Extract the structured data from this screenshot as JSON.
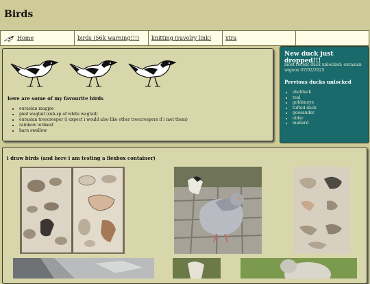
{
  "site": {
    "title": "Birds"
  },
  "nav": {
    "items": [
      {
        "label": "Home"
      },
      {
        "label": "birds (56k warning!!!)"
      },
      {
        "label": "knitting (ravelry link)"
      },
      {
        "label": "xtra"
      },
      {
        "label": ""
      }
    ]
  },
  "favourites": {
    "heading": "here are some of my favourite birds",
    "items": [
      "eurasian magpie",
      "pied wagtail (sub-sp of white wagtail)",
      "eurasian treecreeper (i expect i would also like other treecreepers if i met them)",
      "rainbow lorikeet",
      "barn swallow"
    ]
  },
  "ducks": {
    "title": "New duck just dropped!!!",
    "recent": "most recent duck unlocked: eurasian wigeon 07/02/2025",
    "previous_title": "Previous ducks unlocked",
    "previous": [
      "shelduck",
      "teal",
      "goldeneye",
      "tufted duck",
      "goosander",
      "eider",
      "mallard"
    ]
  },
  "drawings": {
    "heading": "i draw birds (and here i am testing a flexbox container)"
  },
  "colors": {
    "background": "#cfcb98",
    "panel": "#d8d7ac",
    "duck_panel": "#1a6a6c",
    "nav": "#fffde6"
  }
}
